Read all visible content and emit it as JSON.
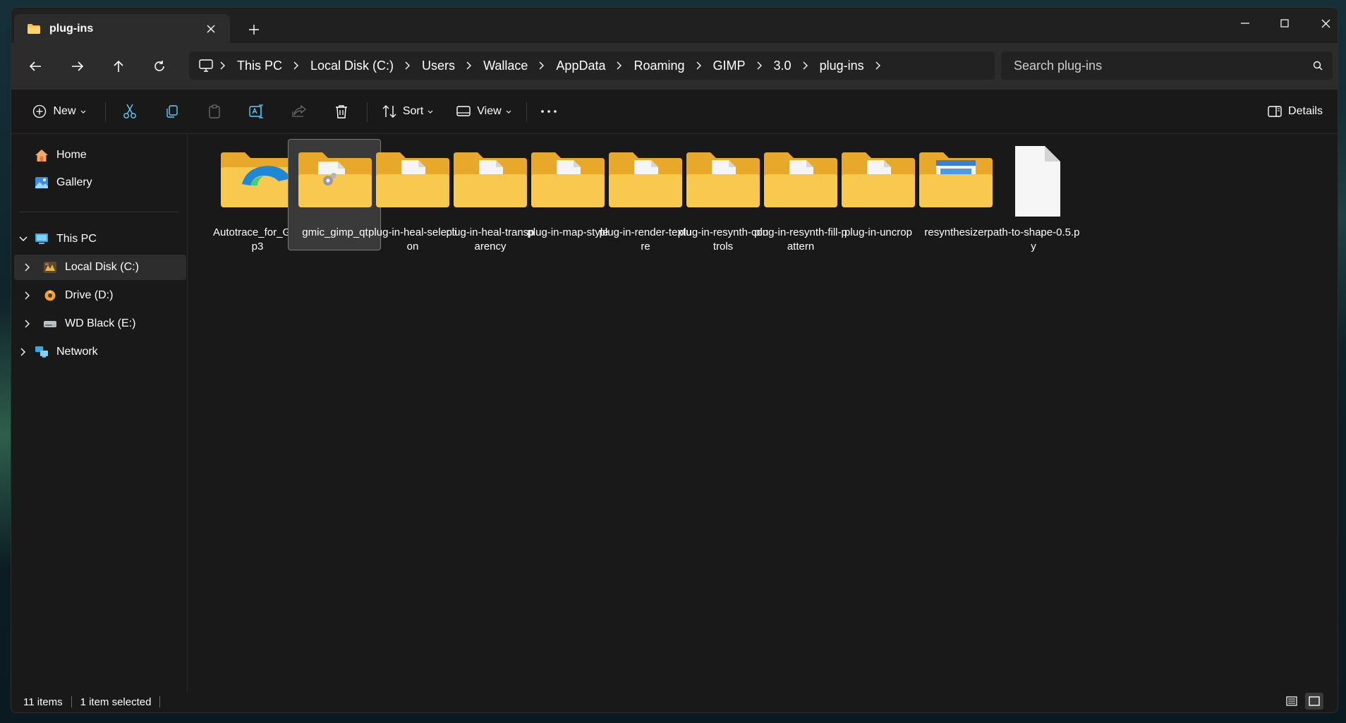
{
  "tab": {
    "title": "plug-ins",
    "icon": "folder-icon"
  },
  "window_controls": [
    "minimize-icon",
    "maximize-icon",
    "close-icon"
  ],
  "breadcrumb": [
    "This PC",
    "Local Disk (C:)",
    "Users",
    "Wallace",
    "AppData",
    "Roaming",
    "GIMP",
    "3.0",
    "plug-ins"
  ],
  "search": {
    "placeholder": "Search plug-ins"
  },
  "toolbar": {
    "new_label": "New",
    "sort_label": "Sort",
    "view_label": "View",
    "details_label": "Details"
  },
  "sidebar": {
    "home": "Home",
    "gallery": "Gallery",
    "this_pc": "This PC",
    "local_disk": "Local Disk (C:)",
    "drive_d": "Drive (D:)",
    "wd_black": "WD Black (E:)",
    "network": "Network"
  },
  "files": [
    {
      "name": "Autotrace_for_Gimp3",
      "icon": "folder-edge-icon",
      "selected": false
    },
    {
      "name": "gmic_gimp_qt",
      "icon": "folder-gear-icon",
      "selected": true
    },
    {
      "name": "plug-in-heal-selection",
      "icon": "folder-doc-icon",
      "selected": false
    },
    {
      "name": "plug-in-heal-transparency",
      "icon": "folder-doc-icon",
      "selected": false
    },
    {
      "name": "plug-in-map-style",
      "icon": "folder-doc-icon",
      "selected": false
    },
    {
      "name": "plug-in-render-texture",
      "icon": "folder-doc-icon",
      "selected": false
    },
    {
      "name": "plug-in-resynth-controls",
      "icon": "folder-doc-icon",
      "selected": false
    },
    {
      "name": "plug-in-resynth-fill-pattern",
      "icon": "folder-doc-icon",
      "selected": false
    },
    {
      "name": "plug-in-uncrop",
      "icon": "folder-doc-icon",
      "selected": false
    },
    {
      "name": "resynthesizer",
      "icon": "folder-window-icon",
      "selected": false
    },
    {
      "name": "path-to-shape-0.5.py",
      "icon": "file-icon",
      "selected": false
    }
  ],
  "status": {
    "items": "11 items",
    "selected": "1 item selected"
  },
  "colors": {
    "folder_front": "#f8c94e",
    "folder_back": "#e8a92a",
    "accent": "#60cdff",
    "window_bg": "#191919"
  }
}
